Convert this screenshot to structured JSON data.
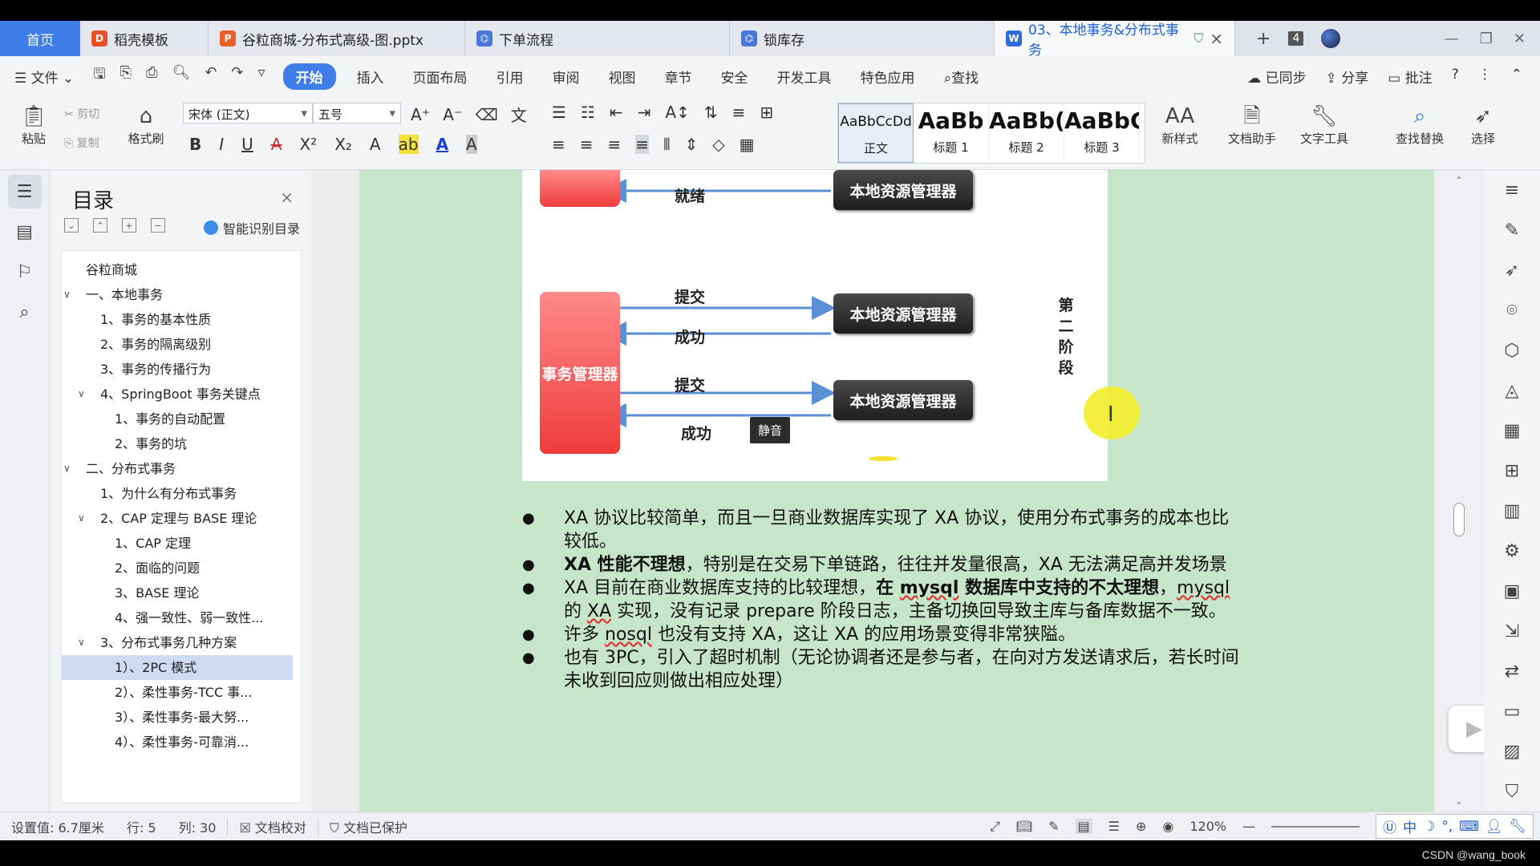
{
  "tabs": {
    "home": "首页",
    "items": [
      {
        "label": "稻壳模板",
        "color": "#e8502a",
        "icon": "daoke-icon"
      },
      {
        "label": "谷粒商城-分布式高级-图.pptx",
        "color": "#e8602a",
        "icon": "ppt-icon"
      },
      {
        "label": "下单流程",
        "color": "#4a78d8",
        "icon": "flow-icon"
      },
      {
        "label": "锁库存",
        "color": "#4a78d8",
        "icon": "flow-icon"
      },
      {
        "label": "03、本地事务&分布式事务",
        "color": "#2f6ad6",
        "icon": "word-icon"
      }
    ],
    "count_badge": "4"
  },
  "menu": {
    "file": "文件",
    "items": [
      "开始",
      "插入",
      "页面布局",
      "引用",
      "审阅",
      "视图",
      "章节",
      "安全",
      "开发工具",
      "特色应用"
    ],
    "search": "查找",
    "synced": "已同步",
    "share": "分享",
    "comment": "批注"
  },
  "ribbon": {
    "paste": "粘贴",
    "cut": "剪切",
    "copy": "复制",
    "format_painter": "格式刷",
    "font_name": "宋体 (正文)",
    "font_size": "五号",
    "styles": [
      {
        "sample": "AaBbCcDd",
        "label": "正文"
      },
      {
        "sample": "AaBb",
        "label": "标题 1"
      },
      {
        "sample": "AaBb(",
        "label": "标题 2"
      },
      {
        "sample": "AaBbC(",
        "label": "标题 3"
      }
    ],
    "new_style": "新样式",
    "doc_assistant": "文档助手",
    "text_tools": "文字工具",
    "find_replace": "查找替换",
    "select": "选择"
  },
  "toc": {
    "title": "目录",
    "smart": "智能识别目录",
    "items": [
      {
        "text": "谷粒商城",
        "level": 0,
        "arrow": ""
      },
      {
        "text": "一、本地事务",
        "level": 0,
        "arrow": "v"
      },
      {
        "text": "1、事务的基本性质",
        "level": 1,
        "arrow": ""
      },
      {
        "text": "2、事务的隔离级别",
        "level": 1,
        "arrow": ""
      },
      {
        "text": "3、事务的传播行为",
        "level": 1,
        "arrow": ""
      },
      {
        "text": "4、SpringBoot 事务关键点",
        "level": 1,
        "arrow": "v"
      },
      {
        "text": "1、事务的自动配置",
        "level": 2,
        "arrow": ""
      },
      {
        "text": "2、事务的坑",
        "level": 2,
        "arrow": ""
      },
      {
        "text": "二、分布式事务",
        "level": 0,
        "arrow": "v"
      },
      {
        "text": "1、为什么有分布式事务",
        "level": 1,
        "arrow": ""
      },
      {
        "text": "2、CAP 定理与 BASE 理论",
        "level": 1,
        "arrow": "v"
      },
      {
        "text": "1、CAP 定理",
        "level": 2,
        "arrow": ""
      },
      {
        "text": "2、面临的问题",
        "level": 2,
        "arrow": ""
      },
      {
        "text": "3、BASE 理论",
        "level": 2,
        "arrow": ""
      },
      {
        "text": "4、强一致性、弱一致性...",
        "level": 2,
        "arrow": ""
      },
      {
        "text": "3、分布式事务几种方案",
        "level": 1,
        "arrow": "v"
      },
      {
        "text": "1）、2PC 模式",
        "level": 2,
        "arrow": "",
        "selected": true
      },
      {
        "text": "2）、柔性事务-TCC 事...",
        "level": 2,
        "arrow": ""
      },
      {
        "text": "3）、柔性事务-最大努...",
        "level": 2,
        "arrow": ""
      },
      {
        "text": "4）、柔性事务-可靠消...",
        "level": 2,
        "arrow": ""
      }
    ]
  },
  "figure": {
    "manager": "本地资源管理器",
    "tm": "事务管理器",
    "ready": "就绪",
    "commit": "提交",
    "success": "成功",
    "phase": "第二阶段",
    "mute": "静音"
  },
  "bullets": [
    {
      "parts": [
        {
          "t": "XA 协议比较简单，而且一旦商业数据库实现了 XA 协议，使用分布式事务的成本也比较低。"
        }
      ]
    },
    {
      "parts": [
        {
          "t": "XA 性能不理想",
          "b": true
        },
        {
          "t": "，特别是在交易下单链路，往往并发量很高，XA 无法满足高并发场景"
        }
      ]
    },
    {
      "parts": [
        {
          "t": "XA 目前在商业数据库支持的比较理想，"
        },
        {
          "t": "在 ",
          "b": true
        },
        {
          "t": "mysql",
          "b": true,
          "u": true
        },
        {
          "t": " 数据库中支持的不太理想",
          "b": true
        },
        {
          "t": "，"
        },
        {
          "t": "mysql",
          "u": true
        },
        {
          "t": " 的 "
        },
        {
          "t": "XA",
          "u": true
        },
        {
          "t": " 实现，没有记录 prepare 阶段日志，主备切换回导致主库与备库数据不一致。"
        }
      ]
    },
    {
      "parts": [
        {
          "t": "许多 "
        },
        {
          "t": "nosql",
          "u": true
        },
        {
          "t": " 也没有支持 XA，这让 XA 的应用场景变得非常狭隘。"
        }
      ]
    },
    {
      "parts": [
        {
          "t": "也有 3PC，引入了超时机制（无论协调者还是参与者，在向对方发送请求后，若长时间未收到回应则做出相应处理）"
        }
      ]
    }
  ],
  "status": {
    "setting": "设置值: 6.7厘米",
    "row": "行: 5",
    "col": "列: 30",
    "proof": "文档校对",
    "protected": "文档已保护",
    "zoom": "120%"
  },
  "ime": "中",
  "watermark": "CSDN @wang_book"
}
